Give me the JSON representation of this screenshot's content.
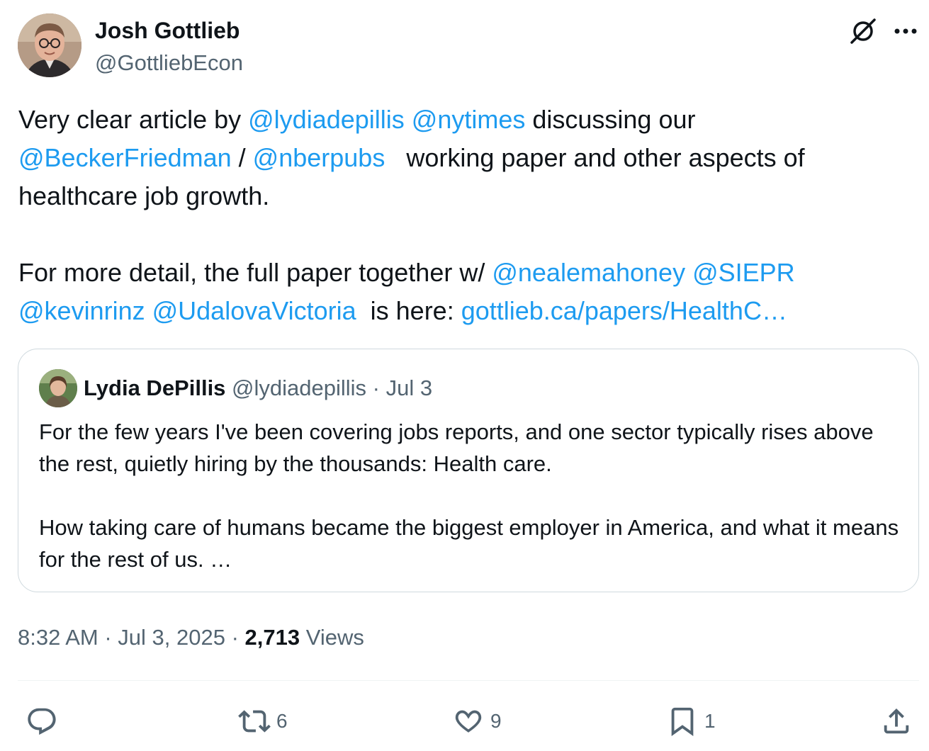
{
  "author": {
    "name": "Josh Gottlieb",
    "handle": "@GottliebEcon"
  },
  "icons": {
    "grok": "grok-icon",
    "more": "more-icon",
    "reply": "reply-icon",
    "repost": "repost-icon",
    "like": "heart-icon",
    "bookmark": "bookmark-icon",
    "share": "share-icon"
  },
  "post": {
    "p1": {
      "t1": "Very clear article by ",
      "m1": "@lydiadepillis",
      "t2": " ",
      "m2": "@nytimes",
      "t3": " discussing our ",
      "m3": "@BeckerFriedman",
      "t4": " / ",
      "m4": "@nberpubs",
      "t5": "   working paper and other aspects of healthcare job growth."
    },
    "p2": {
      "t1": "For more detail, the full paper together w/ ",
      "m1": "@nealemahoney",
      "t2": " ",
      "m2": "@SIEPR",
      "t3": " ",
      "m3": "@kevinrinz",
      "t4": " ",
      "m4": "@UdalovaVictoria",
      "t5": "  is here: ",
      "url": "gottlieb.ca/papers/HealthC…"
    }
  },
  "quote": {
    "name": "Lydia DePillis",
    "meta": " @lydiadepillis · Jul 3",
    "p1": "For the few years I've been covering jobs reports, and one sector typically rises above the rest, quietly hiring by the thousands: Health care.",
    "p2": "How taking care of humans became the biggest employer in America, and what it means for the rest of us. …"
  },
  "meta": {
    "time": "8:32 AM · Jul 3, 2025 · ",
    "views": "2,713",
    "views_label": " Views"
  },
  "actions": {
    "reply_count": "",
    "repost_count": "6",
    "like_count": "9",
    "bookmark_count": "1"
  },
  "colors": {
    "link": "#1d9bf0",
    "muted": "#536471",
    "text": "#0f1419",
    "border": "#cfd9de"
  }
}
